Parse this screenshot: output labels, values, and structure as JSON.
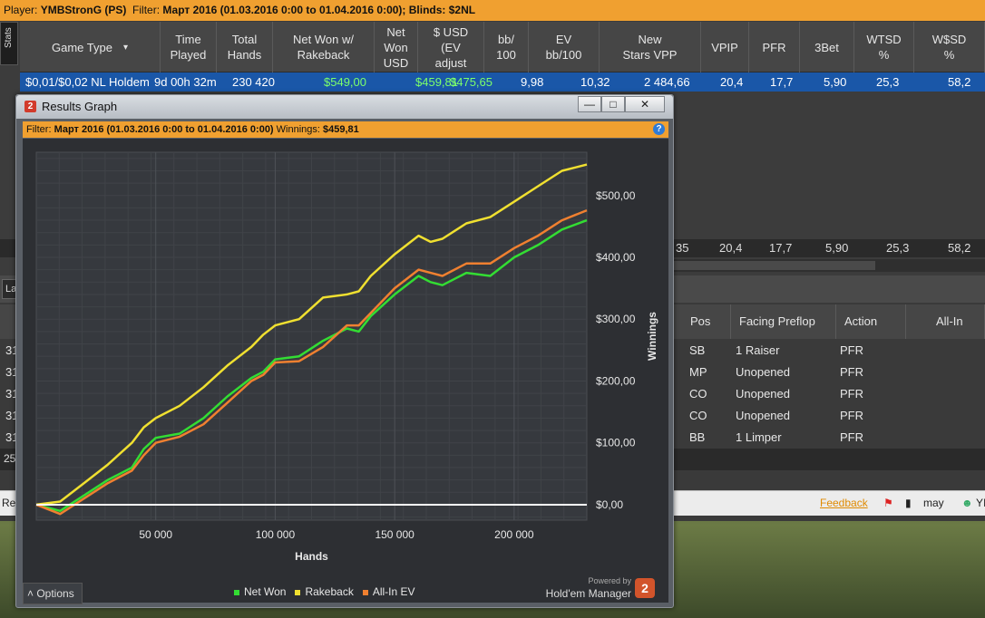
{
  "topbar": {
    "player_label": "Player:",
    "player": "YMBStronG (PS)",
    "filter_label": "Filter:",
    "filter": "Март 2016 (01.03.2016 0:00 to 01.04.2016 0:00); Blinds: $2NL"
  },
  "side_tabs": {
    "stats": "Stats",
    "lower_tab": "La"
  },
  "stats_table": {
    "columns": [
      "Game Type",
      "Time\nPlayed",
      "Total\nHands",
      "Net Won w/\nRakeback",
      "Net\nWon\nUSD",
      "$ USD\n(EV\nadjust",
      "bb/\n100",
      "EV\nbb/100",
      "New\nStars VPP",
      "VPIP",
      "PFR",
      "3Bet",
      "WTSD\n%",
      "W$SD\n%"
    ],
    "row": [
      "$0,01/$0,02 NL Holdem",
      "9d 00h 32m",
      "230 420",
      "$549,00",
      "$459,81",
      "$475,65",
      "9,98",
      "10,32",
      "2 484,66",
      "20,4",
      "17,7",
      "5,90",
      "25,3",
      "58,2"
    ],
    "totals": [
      "35",
      "20,4",
      "17,7",
      "5,90",
      "25,3",
      "58,2"
    ]
  },
  "hands_table": {
    "columns": [
      "Pos",
      "Facing Preflop",
      "Action",
      "All-In"
    ],
    "rows": [
      {
        "lead": "31",
        "pos": "SB",
        "facing": "1 Raiser",
        "action": "PFR"
      },
      {
        "lead": "31",
        "pos": "MP",
        "facing": "Unopened",
        "action": "PFR"
      },
      {
        "lead": "31",
        "pos": "CO",
        "facing": "Unopened",
        "action": "PFR"
      },
      {
        "lead": "31",
        "pos": "CO",
        "facing": "Unopened",
        "action": "PFR"
      },
      {
        "lead": "31",
        "pos": "BB",
        "facing": "1 Limper",
        "action": "PFR"
      }
    ],
    "footer_lead": "25"
  },
  "statusbar": {
    "left": "Re",
    "feedback": "Feedback",
    "user": "may",
    "user2": "YI"
  },
  "results_window": {
    "title": "Results Graph",
    "logo": "2",
    "buttons": {
      "minimize": "—",
      "maximize": "□",
      "close": "✕"
    },
    "filter_label": "Filter:",
    "filter": "Март 2016 (01.03.2016 0:00 to 01.04.2016 0:00)",
    "winnings_label": "Winnings:",
    "winnings": "$459,81",
    "help": "?",
    "options_label": "Options",
    "powered_by": "Powered by",
    "brand": "Hold'em Manager",
    "brand_logo": "2"
  },
  "chart_data": {
    "type": "line",
    "xlabel": "Hands",
    "ylabel": "Winnings",
    "xlim": [
      0,
      230420
    ],
    "ylim": [
      -25,
      570
    ],
    "x_ticks": [
      50000,
      100000,
      150000,
      200000
    ],
    "x_tick_labels": [
      "50 000",
      "100 000",
      "150 000",
      "200 000"
    ],
    "y_ticks": [
      0,
      100,
      200,
      300,
      400,
      500
    ],
    "y_tick_labels": [
      "$0,00",
      "$100,00",
      "$200,00",
      "$300,00",
      "$400,00",
      "$500,00"
    ],
    "grid": true,
    "legend": "bottom",
    "x": [
      0,
      10000,
      20000,
      30000,
      40000,
      45000,
      50000,
      60000,
      70000,
      80000,
      90000,
      95000,
      100000,
      110000,
      120000,
      130000,
      135000,
      140000,
      150000,
      160000,
      165000,
      170000,
      180000,
      190000,
      200000,
      210000,
      220000,
      230420
    ],
    "series": [
      {
        "name": "Net Won",
        "color": "#33dd33",
        "values": [
          0,
          -10,
          15,
          40,
          60,
          90,
          108,
          115,
          140,
          175,
          205,
          215,
          235,
          240,
          265,
          285,
          280,
          305,
          340,
          370,
          360,
          355,
          375,
          370,
          400,
          420,
          445,
          460
        ]
      },
      {
        "name": "Rakeback",
        "color": "#f0e030",
        "values": [
          0,
          5,
          35,
          65,
          100,
          125,
          140,
          160,
          190,
          225,
          255,
          275,
          290,
          300,
          335,
          340,
          345,
          370,
          405,
          435,
          425,
          430,
          455,
          465,
          490,
          515,
          540,
          550
        ]
      },
      {
        "name": "All-In EV",
        "color": "#f08030",
        "values": [
          0,
          -15,
          10,
          35,
          55,
          80,
          100,
          110,
          130,
          165,
          200,
          210,
          230,
          232,
          255,
          290,
          290,
          310,
          350,
          380,
          375,
          370,
          390,
          390,
          415,
          435,
          460,
          476
        ]
      }
    ],
    "zero_line_color": "#ffffff"
  }
}
